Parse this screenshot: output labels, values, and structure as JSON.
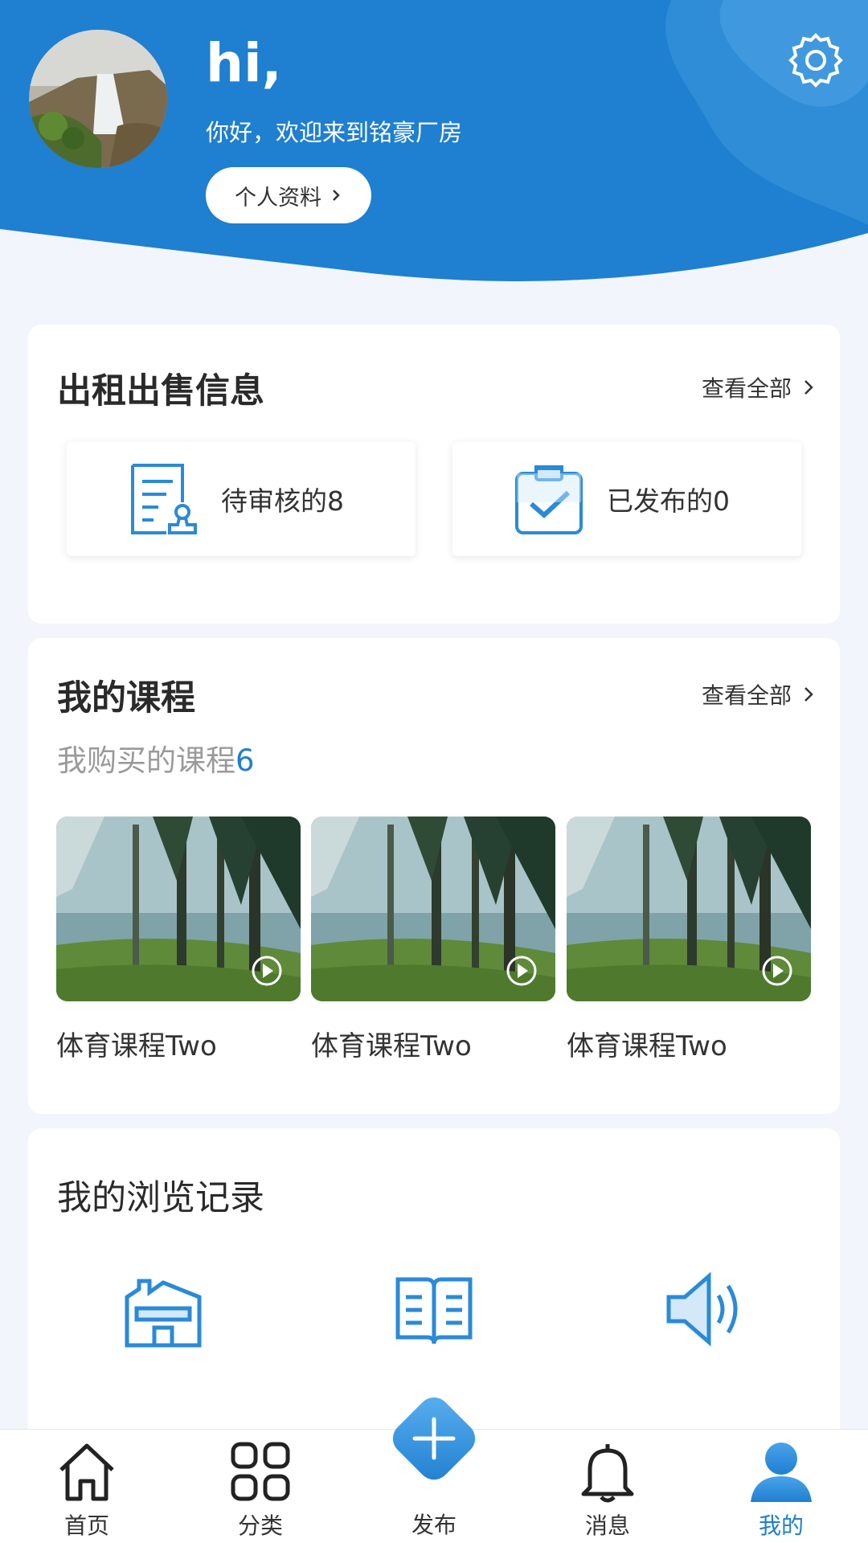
{
  "header": {
    "greeting": "hi,",
    "subtitle": "你好，欢迎来到铭豪厂房",
    "profile_button": "个人资料",
    "bg_color": "#1f7fd0"
  },
  "rental_card": {
    "title": "出租出售信息",
    "see_all": "查看全部",
    "pending": "待审核的8",
    "published": "已发布的0"
  },
  "course_card": {
    "title": "我的课程",
    "see_all": "查看全部",
    "bought_label": "我购买的课程",
    "bought_count": "6",
    "courses": [
      {
        "name": "体育课程Two"
      },
      {
        "name": "体育课程Two"
      },
      {
        "name": "体育课程Two"
      }
    ]
  },
  "history_card": {
    "title": "我的浏览记录",
    "icons": [
      "factory-icon",
      "book-icon",
      "speaker-icon"
    ]
  },
  "bottom_nav": {
    "items": [
      {
        "label": "首页",
        "icon": "home-icon"
      },
      {
        "label": "分类",
        "icon": "grid-icon"
      },
      {
        "label": "发布",
        "icon": "plus-icon"
      },
      {
        "label": "消息",
        "icon": "bell-icon"
      },
      {
        "label": "我的",
        "icon": "user-icon"
      }
    ],
    "active": "我的",
    "accent": "#1f7fd0"
  }
}
